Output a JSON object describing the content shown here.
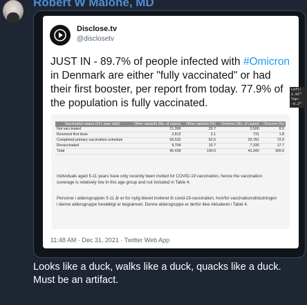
{
  "post": {
    "author": "Robert W Malone, MD",
    "reply_lines": [
      "Looks like a duck, walks like a duck, quacks like a duck.",
      "Must be an artifact."
    ]
  },
  "quoted_tweet": {
    "name": "Disclose.tv",
    "handle": "@disclosetv",
    "text_before": "JUST IN - 89.7% of people infected with ",
    "hashtag": "#Omicron",
    "text_after": " in Denmark are either \"fully vaccinated\" or had their first booster, per report from today. 77.9% of the population is fully vaccinated.",
    "timestamp": "11:48 AM · Dec 31, 2021 · Twitter Web App"
  },
  "tooltip": {
    "line1": "Left: 1.92\"",
    "line2": "Top: -0.2\""
  },
  "table": {
    "headers": [
      "Vaccination status (12+ year olds)",
      "Other variants (No. of cases)",
      "Other variants (%)",
      "Omicron (No. of cases)",
      "Omicron (%)"
    ],
    "rows": [
      [
        "Not vaccinated",
        "21,390",
        "23.7",
        "3,500",
        "8.5"
      ],
      [
        "Received first dose",
        "2,813",
        "3.1",
        "731",
        "1.8"
      ],
      [
        "Completed primary vaccination schedule",
        "56,532",
        "62.5",
        "29,781",
        "72.0"
      ],
      [
        "Revaccinated",
        "9,704",
        "10.7",
        "7,330",
        "17.7"
      ],
      [
        "Total",
        "90,439",
        "100.0",
        "41,342",
        "100.0"
      ]
    ]
  },
  "notes": {
    "english": "Individuals aged 5-11 years have only recently been invited for COVID-19 vaccination, hence the vaccination coverage is relatively low in this age group and not included in Table 4.",
    "danish": "Personer i aldersgruppen 5-11 år er for nylig blevet inviteret til covid-19-vaccination, hvorfor vaccinationstilslutningen i denne aldersgruppe foreløbigt er begrænset. Denne aldersgruppe er derfor ikke inkluderet i Tabel 4."
  },
  "colors": {
    "background": "#1e2633",
    "author": "#4d8fd6",
    "hashtag": "#1d9bf0",
    "table_header": "#8a8a8a"
  }
}
